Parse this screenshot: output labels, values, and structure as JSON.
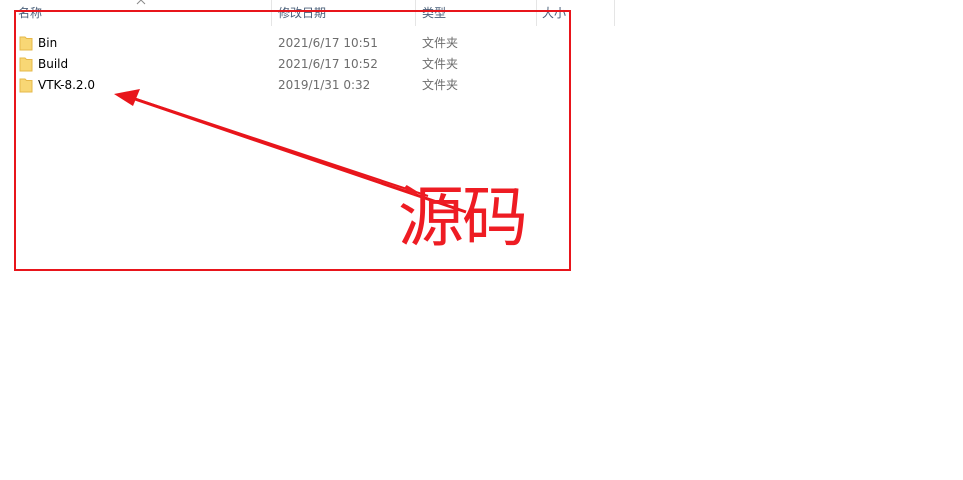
{
  "columns": {
    "name": "名称",
    "modified": "修改日期",
    "type": "类型",
    "size": "大小"
  },
  "rows": [
    {
      "name": "Bin",
      "modified": "2021/6/17 10:51",
      "type": "文件夹",
      "icon": "folder-icon"
    },
    {
      "name": "Build",
      "modified": "2021/6/17 10:52",
      "type": "文件夹",
      "icon": "folder-icon"
    },
    {
      "name": "VTK-8.2.0",
      "modified": "2019/1/31 0:32",
      "type": "文件夹",
      "icon": "folder-icon"
    }
  ],
  "annotation": {
    "label": "源码",
    "color": "#ee1c23"
  },
  "colors": {
    "folder": "#f8d775",
    "folder_dark": "#e6b84a",
    "header_text": "#4c607a",
    "meta_text": "#6d6d6d"
  }
}
